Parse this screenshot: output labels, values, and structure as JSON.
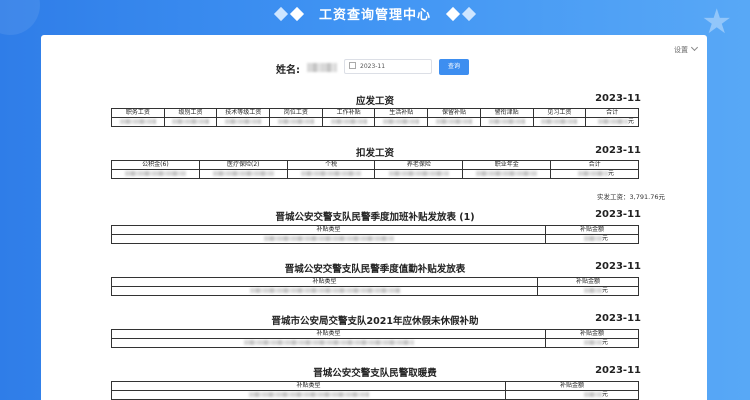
{
  "header": {
    "title": "工资查询管理中心"
  },
  "settings": {
    "label": "设置"
  },
  "search": {
    "name_label": "姓名:",
    "month_value": "2023-11",
    "query_label": "查询"
  },
  "payable": {
    "title": "应发工资",
    "period": "2023-11",
    "columns": [
      "职务工资",
      "级别工资",
      "技术等级工资",
      "岗位工资",
      "工作补贴",
      "生活补贴",
      "保留补贴",
      "警衔津贴",
      "见习工资",
      "合计"
    ],
    "total_suffix": "元"
  },
  "deduction": {
    "title": "扣发工资",
    "period": "2023-11",
    "columns": [
      "公积金(6)",
      "医疗保险(2)",
      "个税",
      "养老保险",
      "职业年金",
      "合计"
    ],
    "total_suffix": "元"
  },
  "net_pay": {
    "text": "实发工资：3,791.76元"
  },
  "allowances": [
    {
      "title": "晋城公安交警支队民警季度加班补贴发放表 (1)",
      "period": "2023-11",
      "type_header": "补贴类型",
      "amount_header": "补贴金额",
      "amount_suffix": "元"
    },
    {
      "title": "晋城公安交警支队民警季度值勤补贴发放表",
      "period": "2023-11",
      "type_header": "补贴类型",
      "amount_header": "补贴金额",
      "amount_suffix": "元"
    },
    {
      "title": "晋城市公安局交警支队2021年应休假未休假补助",
      "period": "2023-11",
      "type_header": "补贴类型",
      "amount_header": "补贴金额",
      "amount_suffix": "元"
    },
    {
      "title": "晋城公安交警支队民警取暖费",
      "period": "2023-11",
      "type_header": "补贴类型",
      "amount_header": "补贴金额",
      "amount_suffix": "元"
    }
  ],
  "theme": {
    "accent": "#3d8ef0",
    "background": "#3f93f3"
  }
}
